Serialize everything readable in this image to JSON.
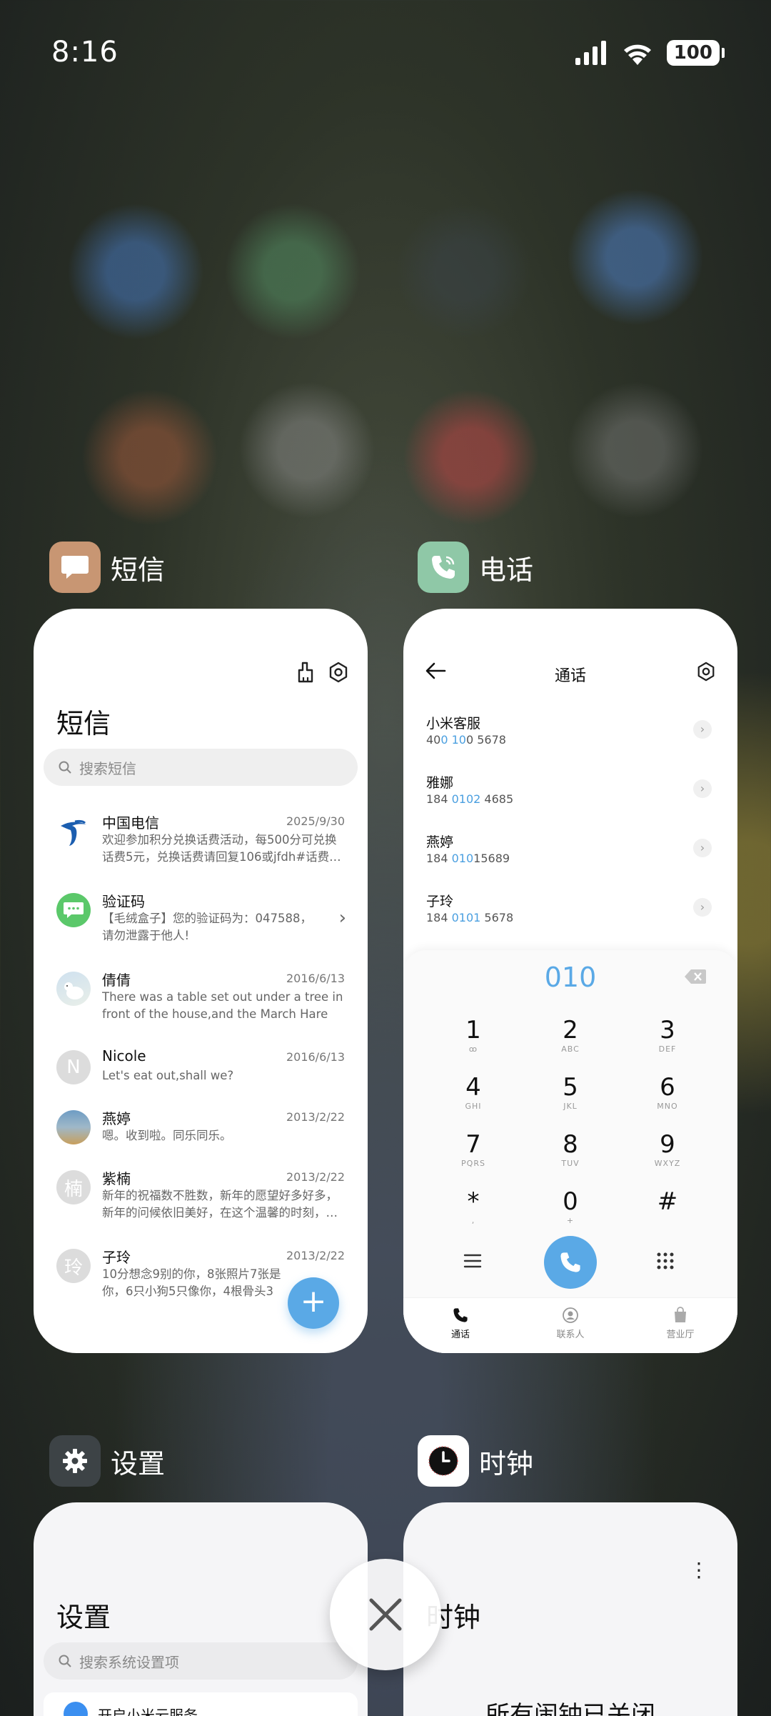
{
  "status_bar": {
    "time": "8:16",
    "battery": "100"
  },
  "apps": [
    {
      "name": "短信",
      "icon": "message-icon",
      "icon_color": "#c89673"
    },
    {
      "name": "电话",
      "icon": "phone-icon",
      "icon_color": "#8fc8a7"
    },
    {
      "name": "设置",
      "icon": "gear-icon",
      "icon_color": "#3d4346"
    },
    {
      "name": "时钟",
      "icon": "clock-icon",
      "icon_color": "#ffffff"
    }
  ],
  "sms": {
    "title": "短信",
    "search_placeholder": "搜索短信",
    "items": [
      {
        "name": "中国电信",
        "date": "2025/9/30",
        "body": "欢迎参加积分兑换话费活动，每500分可兑换话费5元，兑换话费请回复106或jfdh#话费…"
      },
      {
        "name": "验证码",
        "date": "",
        "body": "【毛绒盒子】您的验证码为：047588，请勿泄露于他人!"
      },
      {
        "name": "倩倩",
        "date": "2016/6/13",
        "body": "There was a table set out under a tree in front of the house,and the March Hare an…"
      },
      {
        "name": "Nicole",
        "date": "2016/6/13",
        "body": "Let's eat out,shall we?",
        "avatar_letter": "N"
      },
      {
        "name": "燕婷",
        "date": "2013/2/22",
        "body": "嗯。收到啦。同乐同乐。"
      },
      {
        "name": "紫楠",
        "date": "2013/2/22",
        "body": "新年的祝福数不胜数，新年的愿望好多好多，新年的问候依旧美好，在这个温馨的时刻，…",
        "avatar_letter": "楠"
      },
      {
        "name": "子玲",
        "date": "2013/2/22",
        "body": "10分想念9别的你，8张照片7张是你，6只小狗5只像你，4根骨头3根归你，2爪着地1宗…",
        "avatar_letter": "玲"
      }
    ],
    "fab": "+"
  },
  "phone": {
    "title": "通话",
    "contacts": [
      {
        "name": "小米客服",
        "num_pre": "40",
        "num_hl": "0 10",
        "num_post": "0 5678"
      },
      {
        "name": "雅娜",
        "num_pre": "184 ",
        "num_hl": "0102",
        "num_post": " 4685"
      },
      {
        "name": "燕婷",
        "num_pre": "184 ",
        "num_hl": "010",
        "num_post": "15689"
      },
      {
        "name": "子玲",
        "num_pre": "184 ",
        "num_hl": "0101",
        "num_post": " 5678"
      }
    ],
    "dial_input": "010",
    "keys": [
      {
        "num": "1",
        "sub": "ꝏ"
      },
      {
        "num": "2",
        "sub": "ABC"
      },
      {
        "num": "3",
        "sub": "DEF"
      },
      {
        "num": "4",
        "sub": "GHI"
      },
      {
        "num": "5",
        "sub": "JKL"
      },
      {
        "num": "6",
        "sub": "MNO"
      },
      {
        "num": "7",
        "sub": "PQRS"
      },
      {
        "num": "8",
        "sub": "TUV"
      },
      {
        "num": "9",
        "sub": "WXYZ"
      },
      {
        "num": "*",
        "sub": ","
      },
      {
        "num": "0",
        "sub": "+"
      },
      {
        "num": "#",
        "sub": ""
      }
    ],
    "tabs": [
      "通话",
      "联系人",
      "营业厅"
    ]
  },
  "settings": {
    "title": "设置",
    "search_placeholder": "搜索系统设置项",
    "first_row": "开启小米云服务"
  },
  "clock": {
    "title": "时钟",
    "message": "所有闹钟已关闭"
  }
}
